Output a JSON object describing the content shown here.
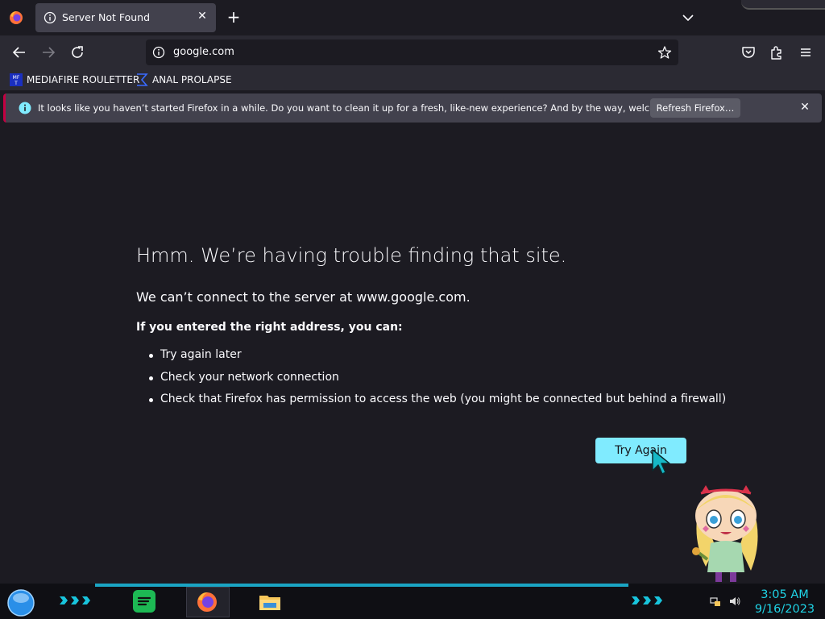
{
  "tab": {
    "title": "Server Not Found"
  },
  "navbar": {
    "url": "google.com"
  },
  "bookmarks": [
    {
      "label": "MEDIAFIRE ROULETTER",
      "icon": "mediafire-icon"
    },
    {
      "label": "ANAL PROLAPSE",
      "icon": "sigma-icon"
    }
  ],
  "notification": {
    "message": "It looks like you haven’t started Firefox in a while. Do you want to clean it up for a fresh, like-new experience? And by the way, welcome back!",
    "button": "Refresh Firefox…"
  },
  "error": {
    "title": "Hmm. We’re having trouble finding that site.",
    "lead": "We can’t connect to the server at www.google.com.",
    "sub": "If you entered the right address, you can:",
    "items": [
      "Try again later",
      "Check your network connection",
      "Check that Firefox has permission to access the web (you might be connected but behind a firewall)"
    ],
    "button": "Try Again"
  },
  "taskbar": {
    "time": "3:05 AM",
    "date": "9/16/2023"
  },
  "colors": {
    "accent": "#80ebff",
    "page_bg": "#1c1b22",
    "toolbar_bg": "#2b2a33",
    "clock": "#1fd4e6"
  }
}
